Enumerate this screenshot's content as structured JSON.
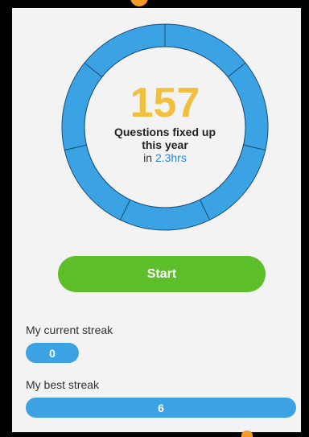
{
  "summary": {
    "count": "157",
    "caption": "Questions fixed up this year",
    "duration_prefix": "in",
    "duration_value": "2.3hrs"
  },
  "start_button": {
    "label": "Start"
  },
  "streaks": {
    "current_label": "My current streak",
    "current_value": "0",
    "best_label": "My best streak",
    "best_value": "6"
  },
  "colors": {
    "ring": "#3ba3e3",
    "count": "#f0c03e",
    "start": "#5cbf2a",
    "accent_dot": "#f59b25"
  },
  "ring": {
    "segments": 7
  }
}
